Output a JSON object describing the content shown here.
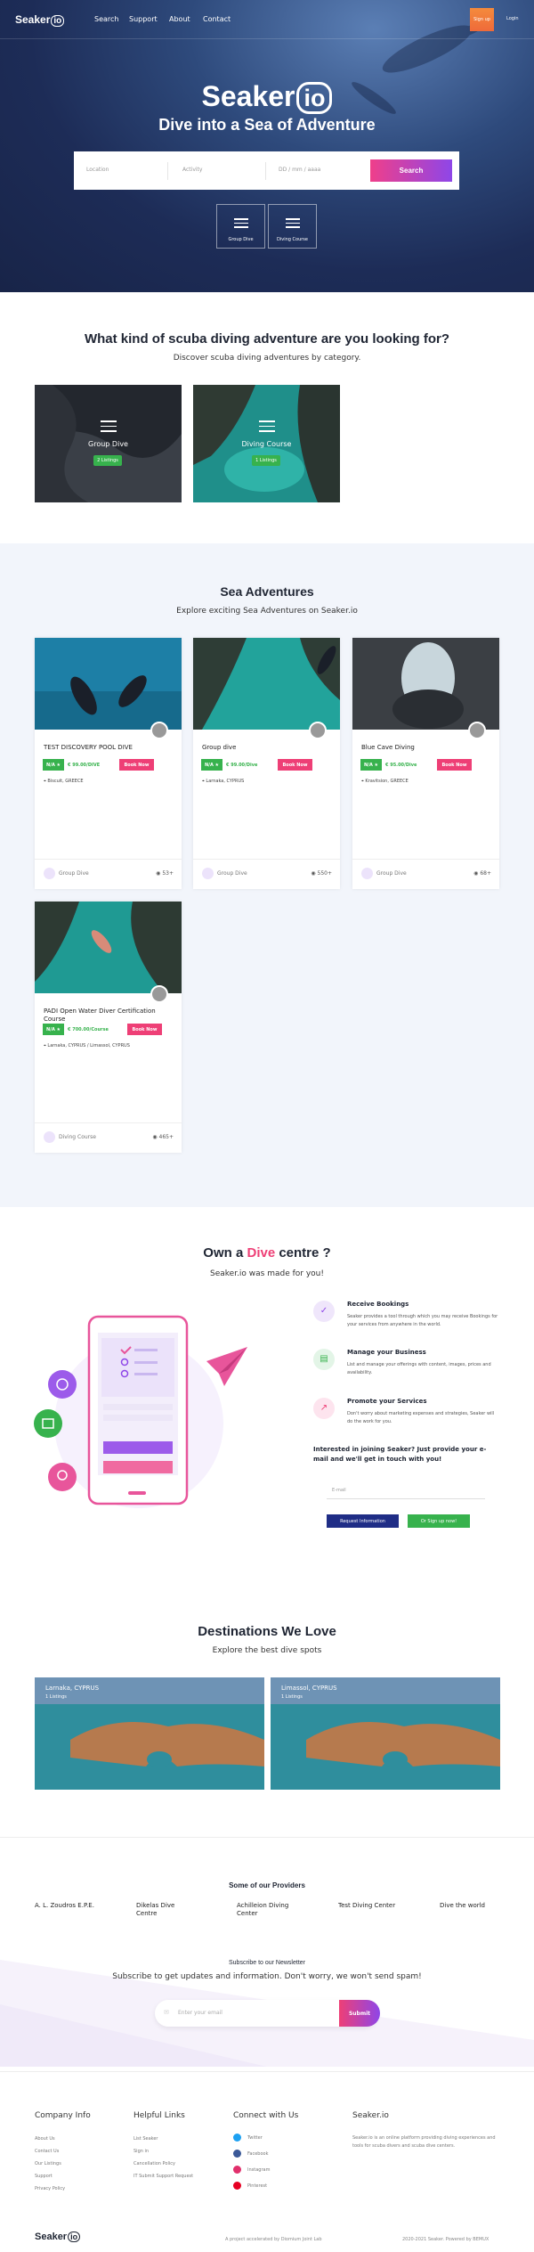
{
  "nav": {
    "logo": "Seaker",
    "logo_io": "io",
    "links": [
      "Search",
      "Support",
      "About",
      "Contact"
    ],
    "signup": "Sign up",
    "login": "Login"
  },
  "hero": {
    "title": "Seaker",
    "title_io": "io",
    "subtitle": "Dive into a Sea of Adventure",
    "search": {
      "location_placeholder": "Location",
      "activity_placeholder": "Activity",
      "date_placeholder": "DD / mm / aaaa",
      "button": "Search"
    },
    "categories": [
      "Group Dive",
      "Diving Course"
    ]
  },
  "categories_section": {
    "title": "What kind of scuba diving adventure are you looking for?",
    "subtitle": "Discover scuba diving adventures by category.",
    "items": [
      {
        "label": "Group Dive",
        "listings": "2 Listings"
      },
      {
        "label": "Diving Course",
        "listings": "1 Listings"
      }
    ]
  },
  "sea_section": {
    "title": "Sea Adventures",
    "subtitle": "Explore exciting Sea Adventures on Seaker.io",
    "cards": [
      {
        "title": "TEST DISCOVERY POOL DIVE",
        "rating": "N/A ★",
        "price": "€ 99.00/DIVE",
        "book": "Book Now",
        "location": "Biscuit, GREECE",
        "type": "Group Dive",
        "views": "53+"
      },
      {
        "title": "Group dive",
        "rating": "N/A ★",
        "price": "€ 99.00/Dive",
        "book": "Book Now",
        "location": "Larnaka, CYPRUS",
        "type": "Group Dive",
        "views": "550+"
      },
      {
        "title": "Blue Cave Diving",
        "rating": "N/A ★",
        "price": "€ 95.00/Dive",
        "book": "Book Now",
        "location": "Kravitsion, GREECE",
        "type": "Group Dive",
        "views": "68+"
      },
      {
        "title": "PADI Open Water Diver Certification Course",
        "rating": "N/A ★",
        "price": "€ 700.00/Course",
        "book": "Book Now",
        "location": "Larnaka, CYPRUS / Limassol, CYPRUS",
        "type": "Diving Course",
        "views": "465+"
      }
    ]
  },
  "centre_section": {
    "title_pre": "Own a ",
    "title_accent": "Dive",
    "title_post": " centre ?",
    "subtitle": "Seaker.io was made for you!",
    "features": [
      {
        "title": "Receive Bookings",
        "desc": "Seaker provides a tool through which you may receive Bookings for your services from anywhere in the world."
      },
      {
        "title": "Manage your Business",
        "desc": "List and manage your offerings with content, images, prices and availability."
      },
      {
        "title": "Promote your Services",
        "desc": "Don't worry about marketing expenses and strategies, Seaker will do the work for you."
      }
    ],
    "cta": "Interested in joining Seaker? Just provide your e-mail and we'll get in touch with you!",
    "email_placeholder": "E-mail",
    "request_button": "Request Information",
    "signup_button": "Or Sign up now!"
  },
  "destinations": {
    "title": "Destinations We Love",
    "subtitle": "Explore the best dive spots",
    "items": [
      {
        "name": "Larnaka, CYPRUS",
        "count": "1 Listings"
      },
      {
        "name": "Limassol, CYPRUS",
        "count": "1 Listings"
      }
    ]
  },
  "providers": {
    "title": "Some of our Providers",
    "items": [
      "A. L. Zoudros E.P.E.",
      "Dikelas Dive Centre",
      "Achilleion Diving Center",
      "Test Diving Center",
      "Dive the world"
    ]
  },
  "newsletter": {
    "title": "Subscribe to our Newsletter",
    "text": "Subscribe to get updates and information. Don't worry, we won't send spam!",
    "placeholder": "Enter your email",
    "button": "Submit"
  },
  "footer": {
    "company_title": "Company Info",
    "company_links": [
      "About Us",
      "Contact Us",
      "Our Listings",
      "Support",
      "Privacy Policy"
    ],
    "helpful_title": "Helpful Links",
    "helpful_links": [
      "List Seaker",
      "Sign in",
      "Cancellation Policy",
      "IT Submit Support Request"
    ],
    "connect_title": "Connect with Us",
    "social": [
      "Twitter",
      "Facebook",
      "Instagram",
      "Pinterest"
    ],
    "about_title": "Seaker.io",
    "about_text": "Seaker.io is an online platform providing diving experiences and tools for scuba divers and scuba dive centers.",
    "bottom_logo": "Seaker",
    "bottom_logo_io": "io",
    "credit": "A project accelerated by Diomium Joint Lab",
    "copyright": "2020-2021 Seaker. Powered by BEMUX"
  },
  "colors": {
    "accent_pink": "#ee3f76",
    "accent_purple": "#8e46e8",
    "green": "#37b24d",
    "navy": "#1f2533"
  }
}
